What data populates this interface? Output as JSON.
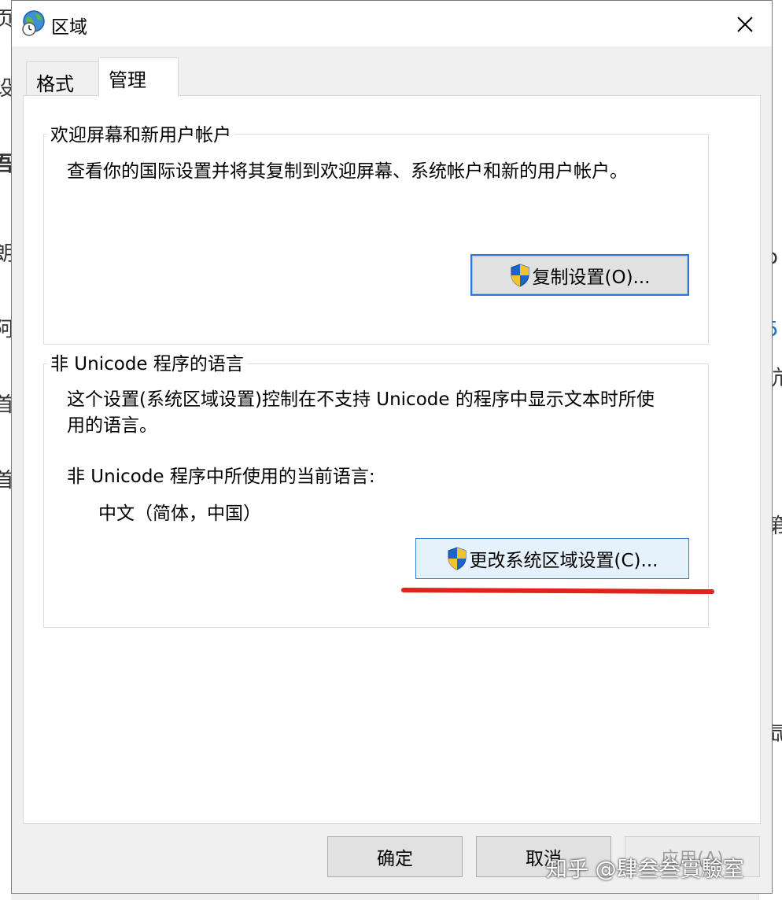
{
  "background": {
    "left_fragments": [
      "页",
      "设",
      "吾",
      "朗",
      "阿",
      "首",
      "首"
    ],
    "right_fragments": [
      "o",
      "5",
      "吭",
      "第",
      "氙"
    ]
  },
  "dialog": {
    "title": "区域",
    "close_symbol": "✕"
  },
  "tabs": [
    {
      "label": "格式"
    },
    {
      "label": "管理"
    }
  ],
  "welcome_group": {
    "title": "欢迎屏幕和新用户帐户",
    "description": "查看你的国际设置并将其复制到欢迎屏幕、系统帐户和新的用户帐户。",
    "button_label": "复制设置(O)..."
  },
  "unicode_group": {
    "title": "非 Unicode 程序的语言",
    "description_line1": "这个设置(系统区域设置)控制在不支持 Unicode 的程序中显示文本时所使",
    "description_line2": "用的语言。",
    "current_label": "非 Unicode 程序中所使用的当前语言:",
    "current_value": "中文（简体，中国）",
    "button_label": "更改系统区域设置(C)..."
  },
  "footer": {
    "ok_label": "确定",
    "cancel_label": "取消",
    "apply_label": "应用(A)"
  },
  "watermark": "知乎 @肆叁叁實驗室",
  "colors": {
    "highlight_border": "#2b79d6",
    "annotation_red": "#e0241c"
  }
}
